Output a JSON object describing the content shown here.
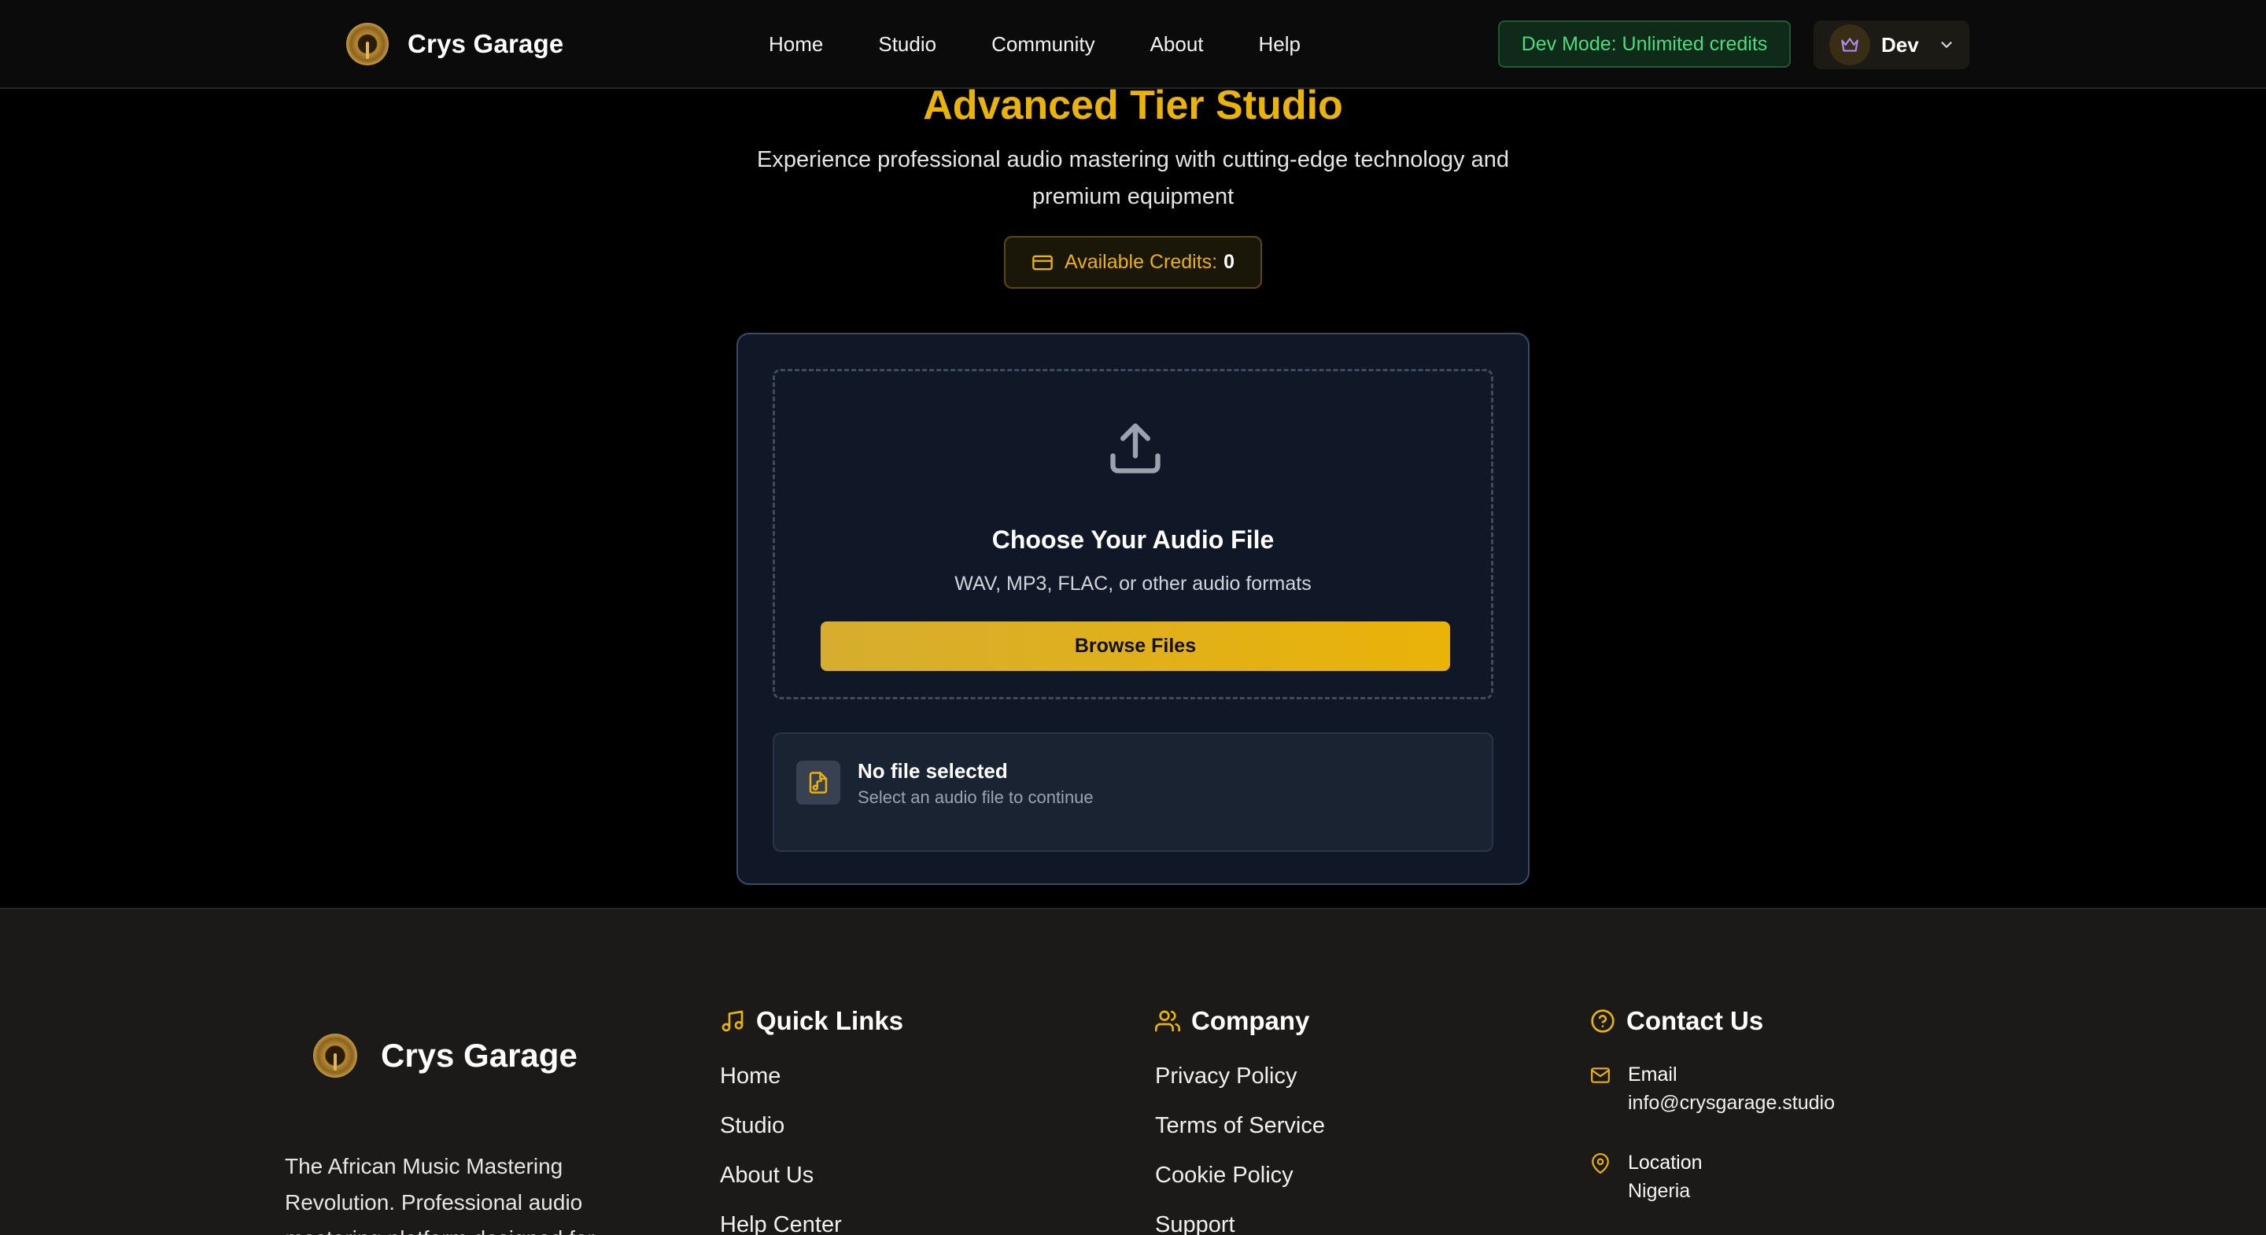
{
  "header": {
    "brand_name": "Crys Garage",
    "nav": [
      "Home",
      "Studio",
      "Community",
      "About",
      "Help"
    ],
    "dev_mode_badge": "Dev Mode: Unlimited credits",
    "user_name": "Dev"
  },
  "hero": {
    "title": "Advanced Tier Studio",
    "subtitle": "Experience professional audio mastering with cutting-edge technology and premium equipment",
    "credits_label": "Available Credits:",
    "credits_value": "0"
  },
  "upload": {
    "title": "Choose Your Audio File",
    "hint": "WAV, MP3, FLAC, or other audio formats",
    "browse_label": "Browse Files",
    "status_title": "No file selected",
    "status_hint": "Select an audio file to continue"
  },
  "footer": {
    "brand_name": "Crys Garage",
    "tagline": "The African Music Mastering Revolution. Professional audio mastering platform designed for",
    "quick_links": {
      "heading": "Quick Links",
      "items": [
        "Home",
        "Studio",
        "About Us",
        "Help Center"
      ]
    },
    "company": {
      "heading": "Company",
      "items": [
        "Privacy Policy",
        "Terms of Service",
        "Cookie Policy",
        "Support"
      ]
    },
    "contact": {
      "heading": "Contact Us",
      "email_label": "Email",
      "email_value": "info@crysgarage.studio",
      "location_label": "Location",
      "location_value": "Nigeria"
    }
  },
  "colors": {
    "accent": "#eab308",
    "success": "#4ade80",
    "card_bg": "#101827",
    "footer_bg": "#1b1a18"
  },
  "icons": [
    "logo",
    "crown-icon",
    "chevron-down-icon",
    "upload-icon",
    "audio-file-icon",
    "credit-card-icon",
    "music-note-icon",
    "users-icon",
    "help-circle-icon",
    "mail-icon",
    "map-pin-icon"
  ]
}
